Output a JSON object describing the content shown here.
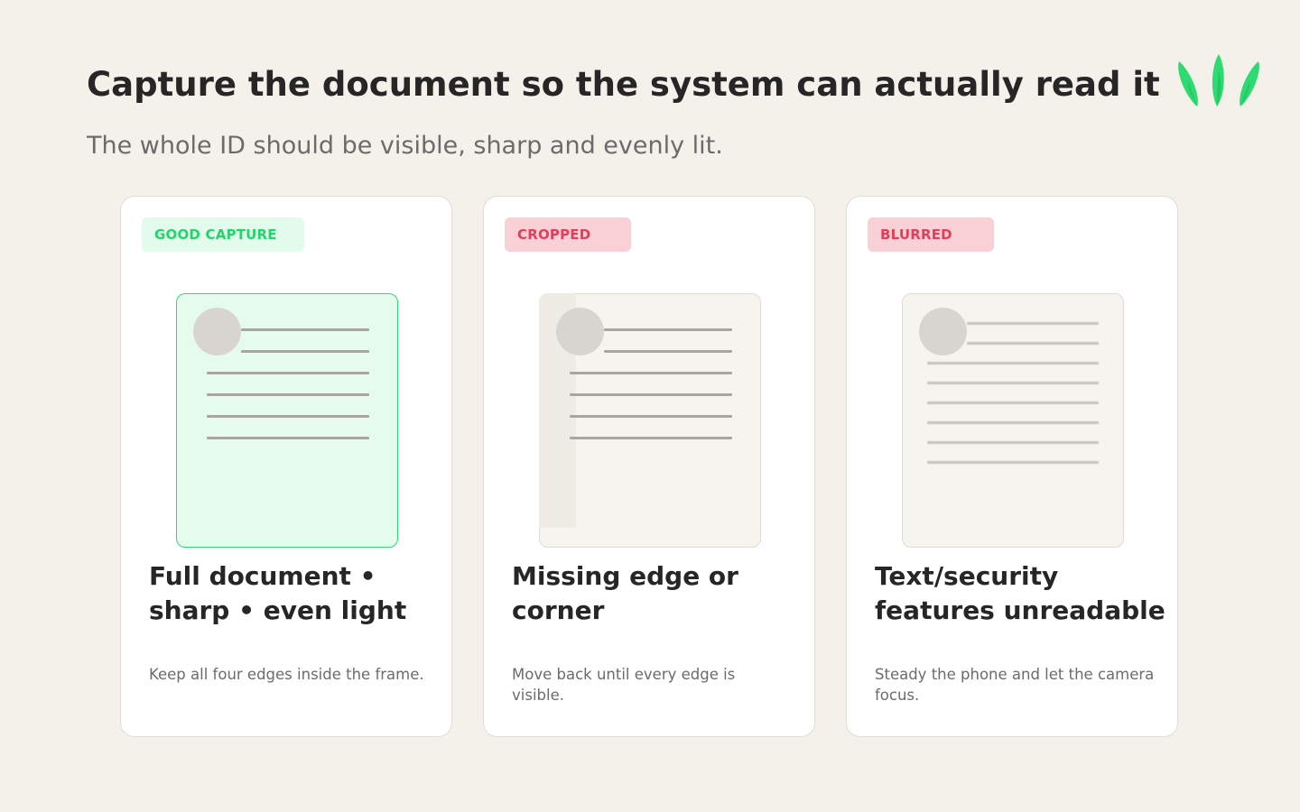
{
  "header": {
    "title": "Capture the document so the system can actually read it",
    "subtitle": "The whole ID should be visible, sharp and evenly lit."
  },
  "logo": {
    "icon": "leaf-blades-logo-icon",
    "color": "#2edb72"
  },
  "cards": [
    {
      "badge": "GOOD CAPTURE",
      "badge_color": "#25d469",
      "headline": "Full document • sharp • even light",
      "caption": "Keep all four edges inside the frame.",
      "illustration": "id-document-icon"
    },
    {
      "badge": "CROPPED",
      "badge_color": "#e23e59",
      "headline": "Missing edge or corner",
      "caption": "Move back until every edge is visible.",
      "illustration": "cropped-id-document-icon"
    },
    {
      "badge": "BLURRED",
      "badge_color": "#e23e59",
      "headline": "Text/security features unreadable",
      "caption": "Steady the phone and let the camera focus.",
      "illustration": "blurred-id-document-icon"
    }
  ]
}
